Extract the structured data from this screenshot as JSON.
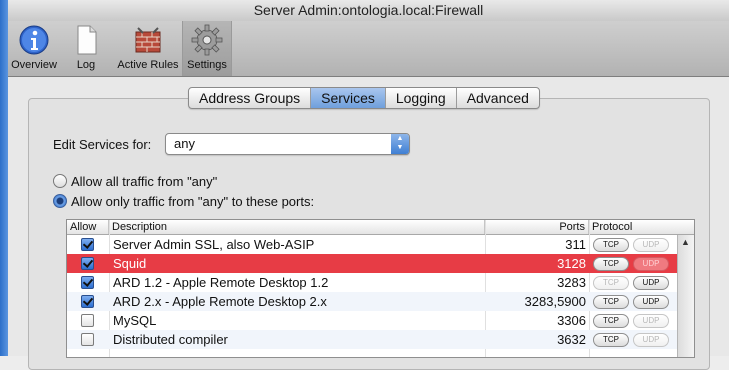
{
  "window": {
    "title": "Server Admin:ontologia.local:Firewall"
  },
  "toolbar": {
    "items": [
      {
        "label": "Overview",
        "icon": "info-icon"
      },
      {
        "label": "Log",
        "icon": "document-icon"
      },
      {
        "label": "Active Rules",
        "icon": "firewall-brick-icon"
      },
      {
        "label": "Settings",
        "icon": "gear-icon"
      }
    ],
    "selected": "Settings"
  },
  "tabs": [
    "Address Groups",
    "Services",
    "Logging",
    "Advanced"
  ],
  "active_tab": "Services",
  "edit_services": {
    "label": "Edit Services for:",
    "value": "any"
  },
  "radios": [
    {
      "label": "Allow all traffic from \"any\"",
      "checked": false
    },
    {
      "label": "Allow only traffic from \"any\" to these ports:",
      "checked": true
    }
  ],
  "table": {
    "headers": {
      "allow": "Allow",
      "description": "Description",
      "ports": "Ports",
      "protocol": "Protocol"
    },
    "rows": [
      {
        "allow": true,
        "description": "Server Admin SSL, also Web-ASIP",
        "ports": "311",
        "tcp": true,
        "udp": false
      },
      {
        "allow": true,
        "description": "Squid",
        "ports": "3128",
        "tcp": true,
        "udp": false,
        "selected": true
      },
      {
        "allow": true,
        "description": "ARD 1.2 - Apple Remote Desktop 1.2",
        "ports": "3283",
        "tcp": false,
        "udp": true
      },
      {
        "allow": true,
        "description": "ARD 2.x - Apple Remote Desktop 2.x",
        "ports": "3283,5900",
        "tcp": true,
        "udp": true
      },
      {
        "allow": false,
        "description": "MySQL",
        "ports": "3306",
        "tcp": true,
        "udp": false
      },
      {
        "allow": false,
        "description": "Distributed compiler",
        "ports": "3632",
        "tcp": true,
        "udp": false
      }
    ],
    "protocol_labels": {
      "tcp": "TCP",
      "udp": "UDP"
    }
  },
  "colors": {
    "selected_row": "#e73c45",
    "accent": "#3b78cf"
  }
}
